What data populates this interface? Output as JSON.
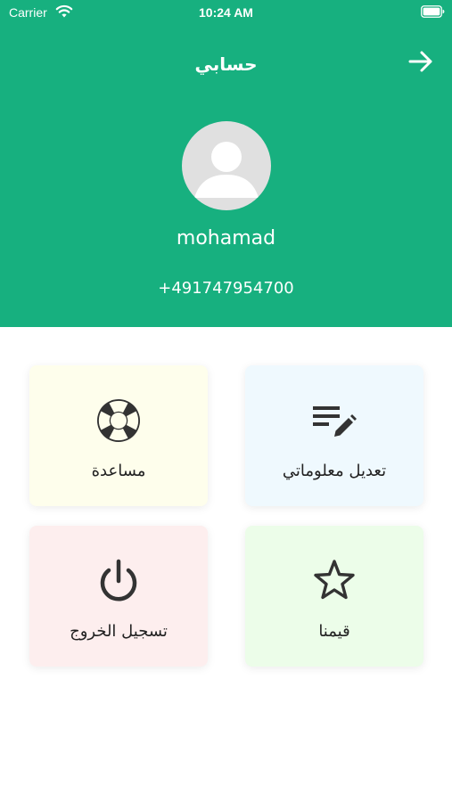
{
  "status_bar": {
    "carrier": "Carrier",
    "time": "10:24 AM"
  },
  "header": {
    "title": "حسابي",
    "back_icon": "arrow-right-icon",
    "background": "#17b07f"
  },
  "profile": {
    "avatar_icon": "user-avatar-icon",
    "name": "mohamad",
    "phone": "+491747954700"
  },
  "menu": {
    "edit": {
      "label": "تعديل معلوماتي",
      "icon": "edit-list-icon",
      "color": "#eff9fe"
    },
    "help": {
      "label": "مساعدة",
      "icon": "lifebuoy-icon",
      "color": "#fefeec"
    },
    "rate": {
      "label": "قيمنا",
      "icon": "star-icon",
      "color": "#ecfde9"
    },
    "logout": {
      "label": "تسجيل الخروج",
      "icon": "power-icon",
      "color": "#fdeeee"
    }
  }
}
